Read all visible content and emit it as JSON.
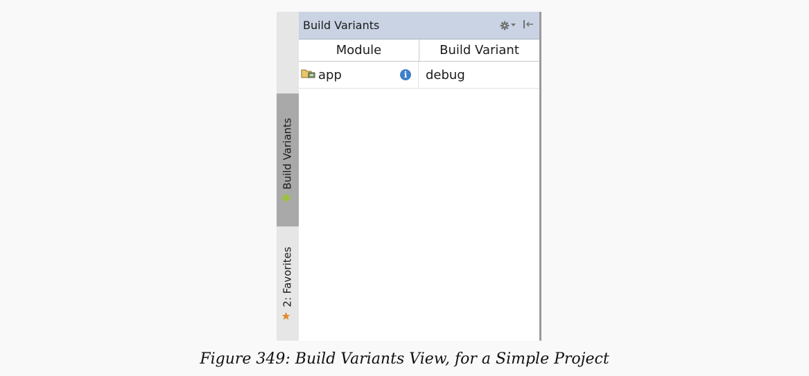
{
  "sidebar": {
    "tabs": [
      {
        "label": "Build Variants",
        "icon": "android-icon",
        "active": true
      },
      {
        "label": "2: Favorites",
        "icon": "star-icon",
        "active": false
      }
    ]
  },
  "panel": {
    "title": "Build Variants",
    "columns": [
      "Module",
      "Build Variant"
    ],
    "rows": [
      {
        "module": "app",
        "variant": "debug"
      }
    ]
  },
  "caption": "Figure 349: Build Variants View, for a Simple Project",
  "colors": {
    "header_bg": "#c9d3e3",
    "active_tab_bg": "#a9a9a9",
    "info_icon": "#3d7fcb",
    "android_green": "#9bc23c",
    "star": "#e08a2e"
  }
}
